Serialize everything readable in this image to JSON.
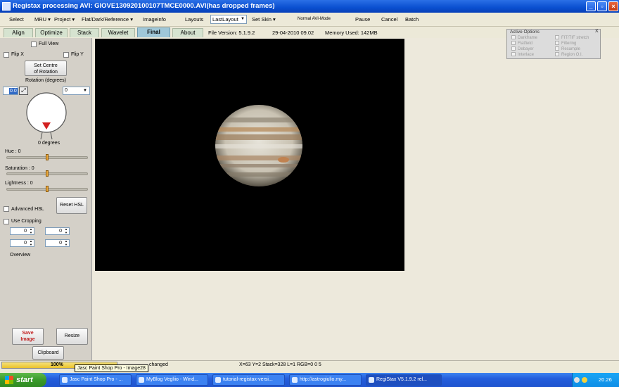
{
  "window": {
    "title": "Registax processing AVI: GIOVE130920100107TMCE0000.AVI(has dropped frames)",
    "minimize_icon": "minimize-icon",
    "maximize_icon": "maximize-icon",
    "close_icon": "close-icon"
  },
  "menubar": {
    "select": "Select",
    "mru": "MRU",
    "project": "Project",
    "flat": "Flat/Dark/Reference",
    "imageinfo": "Imageinfo",
    "layouts": "Layouts",
    "layout_value": "LastLayout",
    "skin": "Set Skin",
    "avi_mode": "Normal AVI-Mode",
    "pause": "Pause",
    "cancel": "Cancel",
    "batch": "Batch"
  },
  "tabs": [
    "Align",
    "Optimize",
    "Stack",
    "Wavelet",
    "Final",
    "About"
  ],
  "active_tab": "Final",
  "info": {
    "file_version": "File Version: 5.1.9.2",
    "datetime": "29-04-2010 09.02",
    "memory": "Memory Used: 142MB"
  },
  "left_panel": {
    "full_view": "Full View",
    "flip_x": "Flip X",
    "flip_y": "Flip Y",
    "set_centre_line1": "Set Centre",
    "set_centre_line2": "of Rotation",
    "rotation_label": "Rotation (degrees)",
    "rotation_value": "0.0",
    "rotation_select": "0",
    "degrees_text": "0 degrees",
    "hue": "Hue : 0",
    "hue_level": 0.5,
    "saturation": "Saturation : 0",
    "saturation_level": 0.5,
    "lightness": "Lightness : 0",
    "lightness_level": 0.5,
    "advanced_hsl": "Advanced HSL",
    "reset_hsl": "Reset HSL",
    "use_cropping": "Use Cropping",
    "crop_values": [
      "0",
      "0",
      "0",
      "0"
    ],
    "overview": "Overview",
    "save_image_line1": "Save",
    "save_image_line2": "Image",
    "resize": "Resize",
    "clipboard": "Clipboard"
  },
  "active_options": {
    "title": "Active Options",
    "close": "X",
    "left": [
      "Darkframe",
      "Flatfield",
      "Debayer",
      "Interlace"
    ],
    "right": [
      "FIT/TIF stretch",
      "Filtering",
      "Resample",
      "Region O.I."
    ]
  },
  "status": {
    "progress_text": "100%",
    "progress_value": 1.0,
    "message": "changed",
    "coords": "X=63 Y=2 Stack=328 L=1 RGB=0 0 5",
    "tooltip": "Jasc Paint Shop Pro - Image28"
  },
  "taskbar": {
    "start": "start",
    "tasks": [
      "Jasc Paint Shop Pro - ...",
      "MyBlog Vegliio - Wind...",
      "tutorial-registax-versi...",
      "http://astrogiulio.my...",
      "RegiStax V5.1.9.2 rel..."
    ],
    "clock": "20.26"
  },
  "colors": {
    "accent_red": "#d21f1f",
    "slider_thumb": "#e8a63a",
    "image_background": "#000000"
  }
}
